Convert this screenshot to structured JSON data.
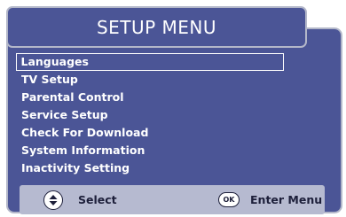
{
  "header": {
    "title": "SETUP MENU"
  },
  "menu": {
    "selected_index": 0,
    "items": [
      {
        "label": "Languages"
      },
      {
        "label": "TV Setup"
      },
      {
        "label": "Parental Control"
      },
      {
        "label": "Service Setup"
      },
      {
        "label": "Check For Download"
      },
      {
        "label": "System Information"
      },
      {
        "label": "Inactivity Setting"
      }
    ]
  },
  "footer": {
    "select_label": "Select",
    "select_icon": "dpad-up-down-icon",
    "ok_icon_text": "OK",
    "enter_label": "Enter Menu"
  },
  "colors": {
    "panel": "#4b5596",
    "border": "#b3b7c9",
    "footer": "#b6bad0",
    "text": "#ffffff",
    "footer_text": "#1d1f3a"
  }
}
